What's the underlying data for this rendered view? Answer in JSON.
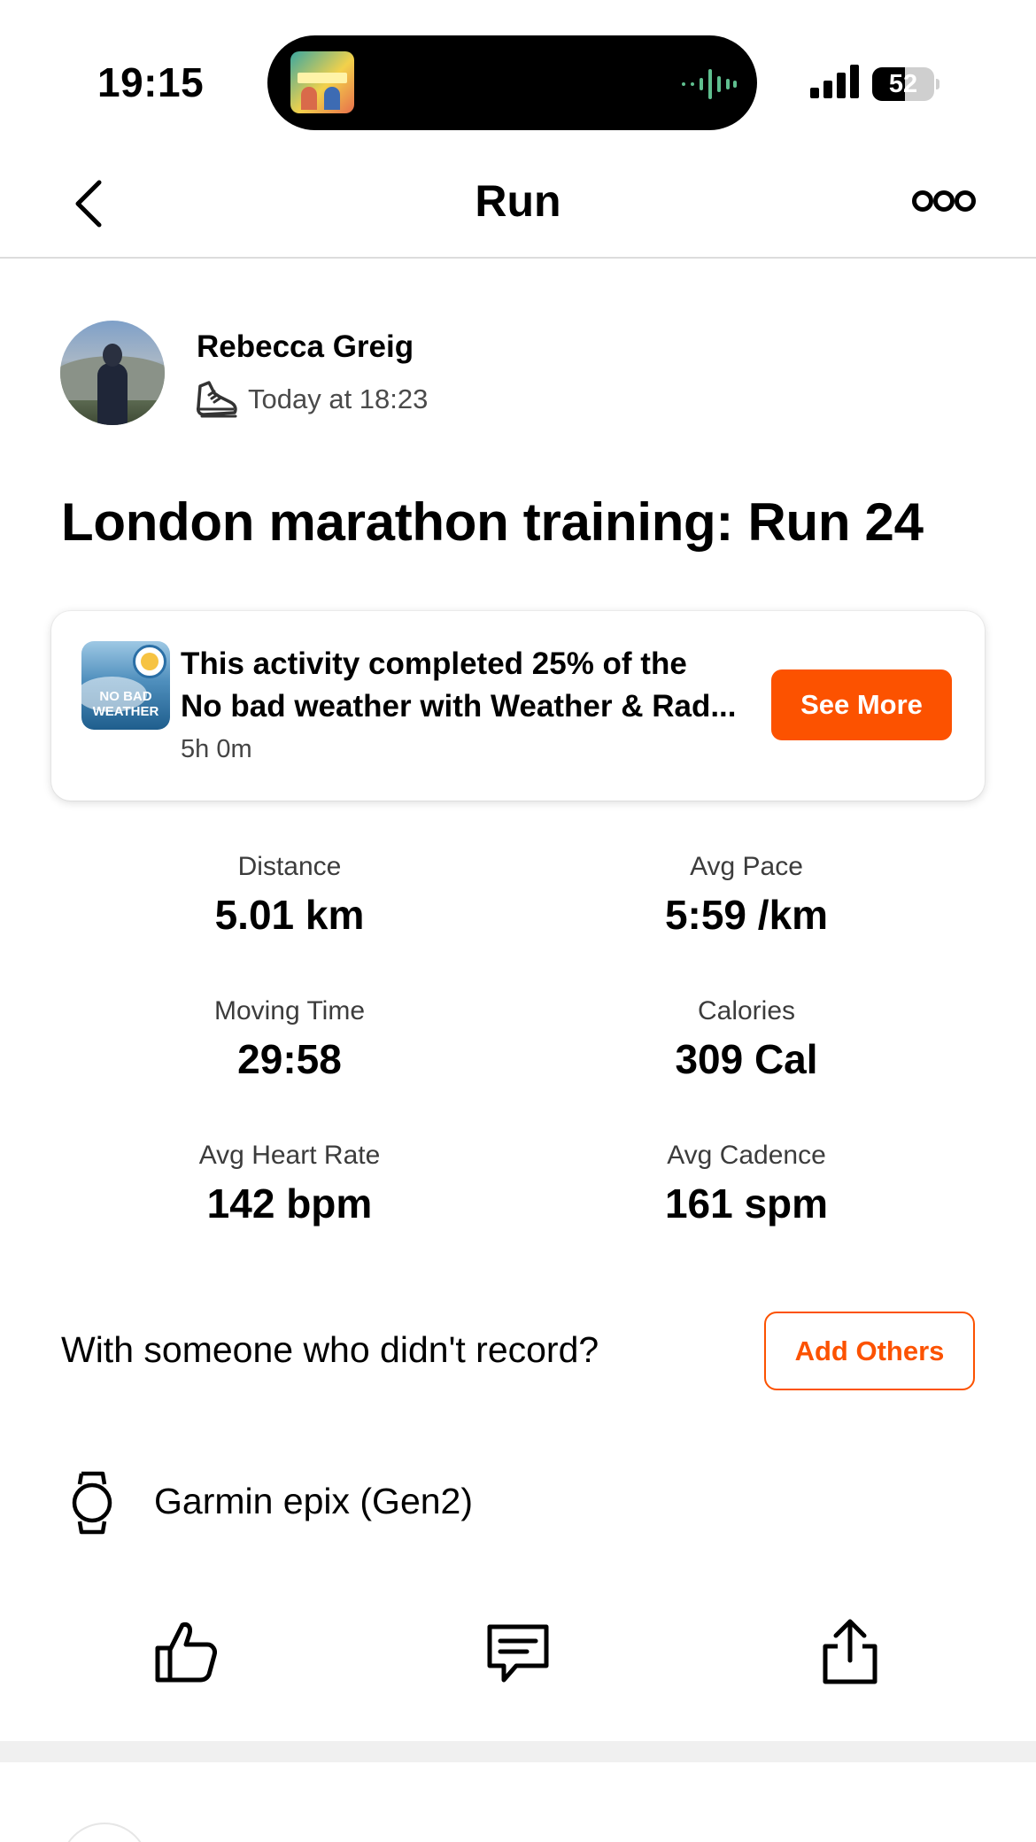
{
  "status_bar": {
    "time": "19:15",
    "battery": "52"
  },
  "nav": {
    "title": "Run"
  },
  "athlete": {
    "name": "Rebecca Greig",
    "timestamp": "Today at 18:23"
  },
  "activity": {
    "title": "London marathon training: Run 24"
  },
  "challenge": {
    "line1": "This activity completed 25% of the",
    "line2": "No bad weather with Weather & Rad...",
    "sub": "5h 0m",
    "badge_text_line1": "NO BAD",
    "badge_text_line2": "WEATHER",
    "button_label": "See More"
  },
  "stats": [
    {
      "label": "Distance",
      "value": "5.01 km"
    },
    {
      "label": "Avg Pace",
      "value": "5:59 /km"
    },
    {
      "label": "Moving Time",
      "value": "29:58"
    },
    {
      "label": "Calories",
      "value": "309 Cal"
    },
    {
      "label": "Avg Heart Rate",
      "value": "142 bpm"
    },
    {
      "label": "Avg Cadence",
      "value": "161 spm"
    }
  ],
  "with_others": {
    "text": "With someone who didn't record?",
    "button_label": "Add Others"
  },
  "device": {
    "name": "Garmin epix (Gen2)"
  },
  "colors": {
    "accent": "#fc5200",
    "divider": "#dcdcdc"
  },
  "icons": [
    "back-chevron-icon",
    "more-options-icon",
    "running-shoe-icon",
    "watch-icon",
    "kudos-thumbs-up-icon",
    "comment-icon",
    "share-icon"
  ]
}
